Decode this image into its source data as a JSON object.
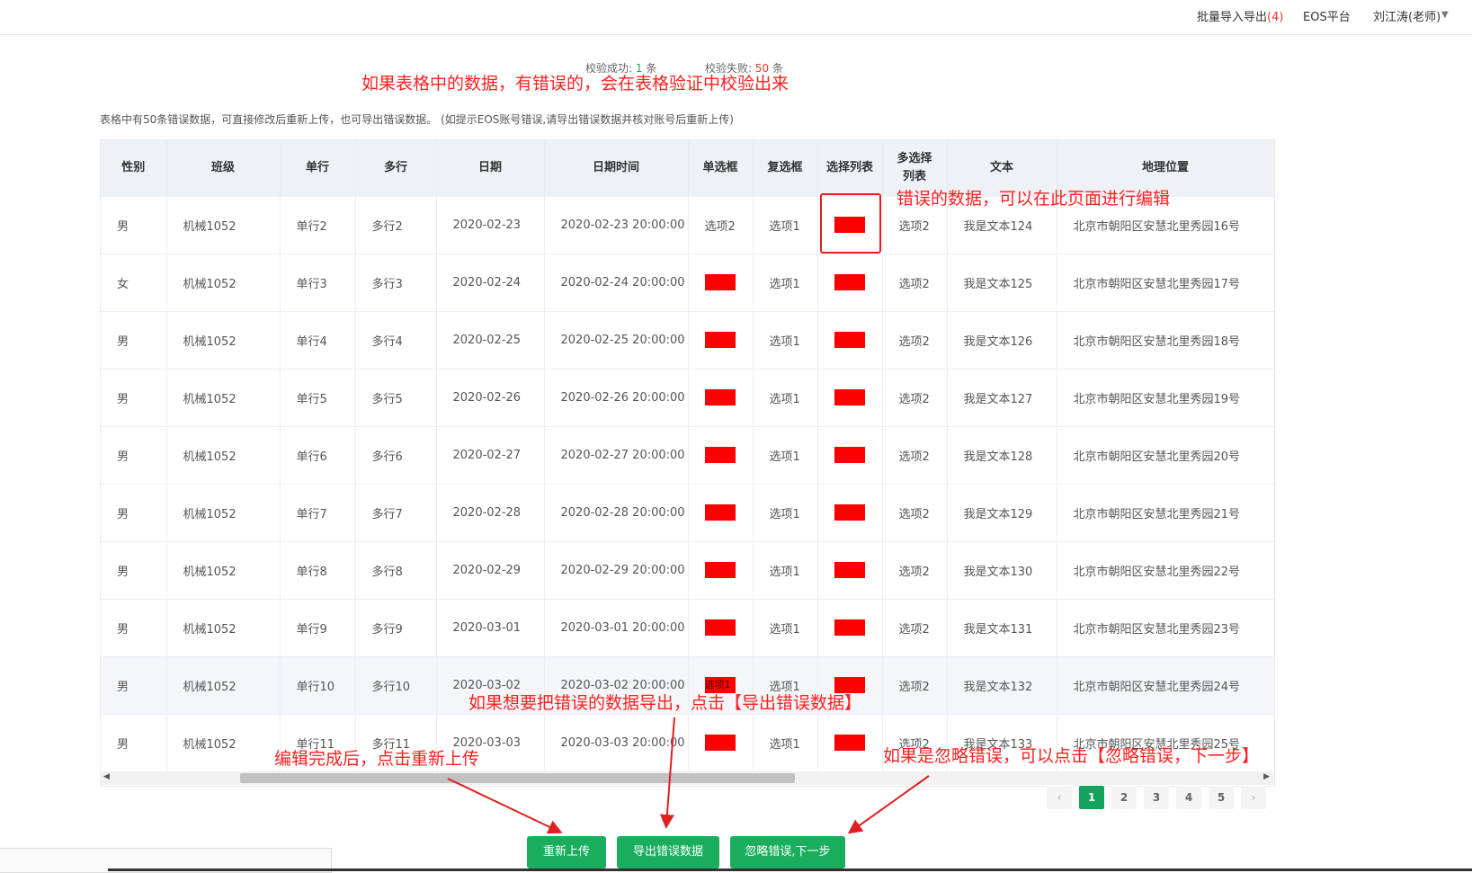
{
  "topbar": {
    "batch_label": "批量导入导出",
    "batch_count": "(4)",
    "platform": "EOS平台",
    "user": "刘江涛(老师)"
  },
  "summary": {
    "success_label": "校验成功:",
    "success_count": "1",
    "success_unit": "条",
    "fail_label": "校验失败:",
    "fail_count": "50",
    "fail_unit": "条"
  },
  "hint": "表格中有50条错误数据，可直接修改后重新上传，也可导出错误数据。 (如提示EOS账号错误,请导出错误数据并核对账号后重新上传)",
  "annotations": {
    "top": "如果表格中的数据，有错误的，会在表格验证中校验出来",
    "edit": "错误的数据，可以在此页面进行编辑",
    "export": "如果想要把错误的数据导出，点击【导出错误数据】",
    "reupload": "编辑完成后，点击重新上传",
    "ignore": "如果是忽略错误，可以点击【忽略错误，下一步】"
  },
  "table": {
    "headers": [
      "性别",
      "班级",
      "单行",
      "多行",
      "日期",
      "日期时间",
      "单选框",
      "复选框",
      "选择列表",
      "多选择列表",
      "文本",
      "地理位置"
    ],
    "rows": [
      [
        "男",
        "机械1052",
        "单行2",
        "多行2",
        "2020-02-23",
        "2020-02-23 20:00:00",
        "选项2",
        "选项1",
        "",
        "选项2",
        "我是文本124",
        "北京市朝阳区安慧北里秀园16号"
      ],
      [
        "女",
        "机械1052",
        "单行3",
        "多行3",
        "2020-02-24",
        "2020-02-24 20:00:00",
        "",
        "选项1",
        "",
        "选项2",
        "我是文本125",
        "北京市朝阳区安慧北里秀园17号"
      ],
      [
        "男",
        "机械1052",
        "单行4",
        "多行4",
        "2020-02-25",
        "2020-02-25 20:00:00",
        "",
        "选项1",
        "",
        "选项2",
        "我是文本126",
        "北京市朝阳区安慧北里秀园18号"
      ],
      [
        "男",
        "机械1052",
        "单行5",
        "多行5",
        "2020-02-26",
        "2020-02-26 20:00:00",
        "",
        "选项1",
        "",
        "选项2",
        "我是文本127",
        "北京市朝阳区安慧北里秀园19号"
      ],
      [
        "男",
        "机械1052",
        "单行6",
        "多行6",
        "2020-02-27",
        "2020-02-27 20:00:00",
        "",
        "选项1",
        "",
        "选项2",
        "我是文本128",
        "北京市朝阳区安慧北里秀园20号"
      ],
      [
        "男",
        "机械1052",
        "单行7",
        "多行7",
        "2020-02-28",
        "2020-02-28 20:00:00",
        "",
        "选项1",
        "",
        "选项2",
        "我是文本129",
        "北京市朝阳区安慧北里秀园21号"
      ],
      [
        "男",
        "机械1052",
        "单行8",
        "多行8",
        "2020-02-29",
        "2020-02-29 20:00:00",
        "",
        "选项1",
        "",
        "选项2",
        "我是文本130",
        "北京市朝阳区安慧北里秀园22号"
      ],
      [
        "男",
        "机械1052",
        "单行9",
        "多行9",
        "2020-03-01",
        "2020-03-01 20:00:00",
        "",
        "选项1",
        "",
        "选项2",
        "我是文本131",
        "北京市朝阳区安慧北里秀园23号"
      ],
      [
        "男",
        "机械1052",
        "单行10",
        "多行10",
        "2020-03-02",
        "2020-03-02 20:00:00",
        "选项1",
        "选项1",
        "",
        "选项2",
        "我是文本132",
        "北京市朝阳区安慧北里秀园24号"
      ],
      [
        "男",
        "机械1052",
        "单行11",
        "多行11",
        "2020-03-03",
        "2020-03-03 20:00:00",
        "",
        "选项1",
        "",
        "选项2",
        "我是文本133",
        "北京市朝阳区安慧北里秀园25号"
      ]
    ]
  },
  "pagination": {
    "pages": [
      "1",
      "2",
      "3",
      "4",
      "5"
    ],
    "current": "1",
    "prev": "‹",
    "next": "›"
  },
  "buttons": {
    "reupload": "重新上传",
    "export": "导出错误数据",
    "ignore": "忽略错误,下一步"
  },
  "colors": {
    "accent": "#1aad5e",
    "error": "#ff0000",
    "annotation": "#ff2020"
  }
}
